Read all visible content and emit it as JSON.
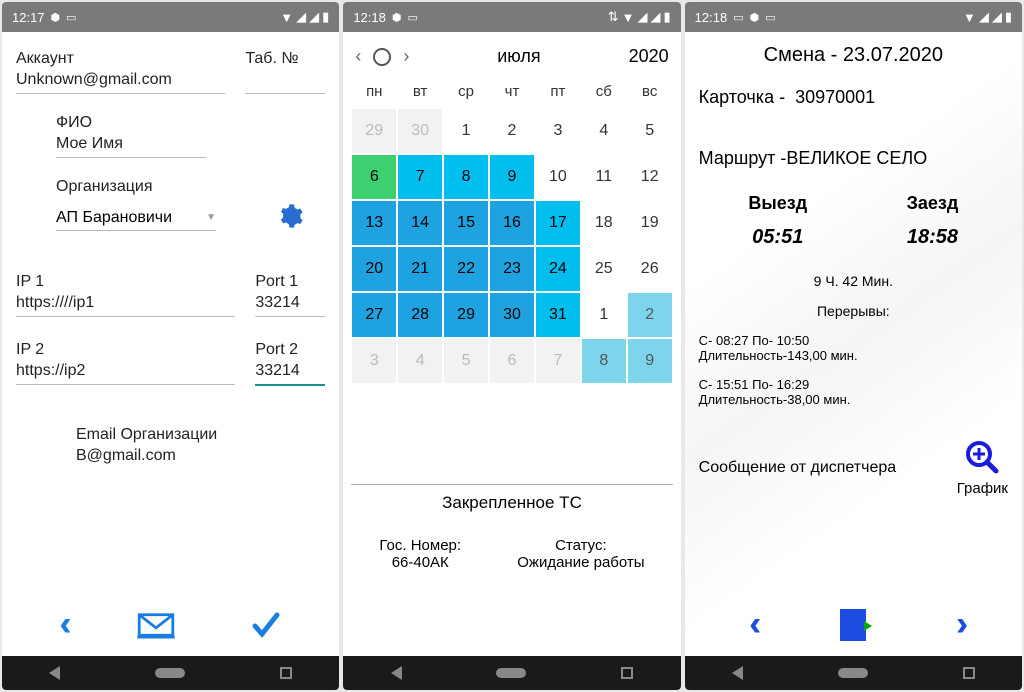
{
  "screen1": {
    "status": {
      "time": "12:17"
    },
    "account_label": "Аккаунт",
    "tab_label": "Таб. №",
    "account_value": "Unknown@gmail.com",
    "fio_label": "ФИО",
    "fio_value": "Мое Имя",
    "org_label": "Организация",
    "org_value": "АП Барановичи",
    "ip1_label": "IP 1",
    "ip1_value": "https:////ip1",
    "port1_label": "Port 1",
    "port1_value": "33214",
    "ip2_label": "IP 2",
    "ip2_value": "https://ip2",
    "port2_label": "Port 2",
    "port2_value": "33214",
    "email_label": "Email Организации",
    "email_value": "B@gmail.com"
  },
  "screen2": {
    "status": {
      "time": "12:18"
    },
    "month": "июля",
    "year": "2020",
    "dow": [
      "пн",
      "вт",
      "ср",
      "чт",
      "пт",
      "сб",
      "вс"
    ],
    "cells": [
      {
        "d": "29",
        "cls": "prev-month"
      },
      {
        "d": "30",
        "cls": "prev-month"
      },
      {
        "d": "1",
        "cls": "off"
      },
      {
        "d": "2",
        "cls": "off"
      },
      {
        "d": "3",
        "cls": "off"
      },
      {
        "d": "4",
        "cls": "off"
      },
      {
        "d": "5",
        "cls": "off"
      },
      {
        "d": "6",
        "cls": "green"
      },
      {
        "d": "7",
        "cls": "c1"
      },
      {
        "d": "8",
        "cls": "c1"
      },
      {
        "d": "9",
        "cls": "c1"
      },
      {
        "d": "10",
        "cls": "off"
      },
      {
        "d": "11",
        "cls": "off"
      },
      {
        "d": "12",
        "cls": "off"
      },
      {
        "d": "13",
        "cls": "c2"
      },
      {
        "d": "14",
        "cls": "c2"
      },
      {
        "d": "15",
        "cls": "c2"
      },
      {
        "d": "16",
        "cls": "c2"
      },
      {
        "d": "17",
        "cls": "c1"
      },
      {
        "d": "18",
        "cls": "off"
      },
      {
        "d": "19",
        "cls": "off"
      },
      {
        "d": "20",
        "cls": "c2"
      },
      {
        "d": "21",
        "cls": "c2"
      },
      {
        "d": "22",
        "cls": "c2"
      },
      {
        "d": "23",
        "cls": "c2"
      },
      {
        "d": "24",
        "cls": "c1"
      },
      {
        "d": "25",
        "cls": "off"
      },
      {
        "d": "26",
        "cls": "off"
      },
      {
        "d": "27",
        "cls": "c2"
      },
      {
        "d": "28",
        "cls": "c2"
      },
      {
        "d": "29",
        "cls": "c2"
      },
      {
        "d": "30",
        "cls": "c2"
      },
      {
        "d": "31",
        "cls": "c1"
      },
      {
        "d": "1",
        "cls": "off prev-month"
      },
      {
        "d": "2",
        "cls": "c3"
      },
      {
        "d": "3",
        "cls": "prev-month"
      },
      {
        "d": "4",
        "cls": "prev-month"
      },
      {
        "d": "5",
        "cls": "prev-month"
      },
      {
        "d": "6",
        "cls": "prev-month"
      },
      {
        "d": "7",
        "cls": "prev-month"
      },
      {
        "d": "8",
        "cls": "c3"
      },
      {
        "d": "9",
        "cls": "c3"
      }
    ],
    "vehicle_title": "Закрепленное ТС",
    "gos_label": "Гос. Номер:",
    "gos_value": "66-40АК",
    "status_label": "Статус:",
    "status_value": "Ожидание работы"
  },
  "screen3": {
    "status": {
      "time": "12:18"
    },
    "shift_title": "Смена - 23.07.2020",
    "card_label": "Карточка -",
    "card_value": "30970001",
    "route_label": "Маршрут -ВЕЛИКОЕ СЕЛО",
    "depart_label": "Выезд",
    "depart_time": "05:51",
    "arrive_label": "Заезд",
    "arrive_time": "18:58",
    "duration": "9 Ч.  42 Мин.",
    "breaks_title": "Перерывы:",
    "break1_line1": "С- 08:27  По- 10:50",
    "break1_line2": "Длительность-143,00 мин.",
    "break2_line1": "С- 15:51  По- 16:29",
    "break2_line2": "Длительность-38,00 мин.",
    "dispatch_label": "Сообщение от диспетчера",
    "chart_label": "График"
  }
}
